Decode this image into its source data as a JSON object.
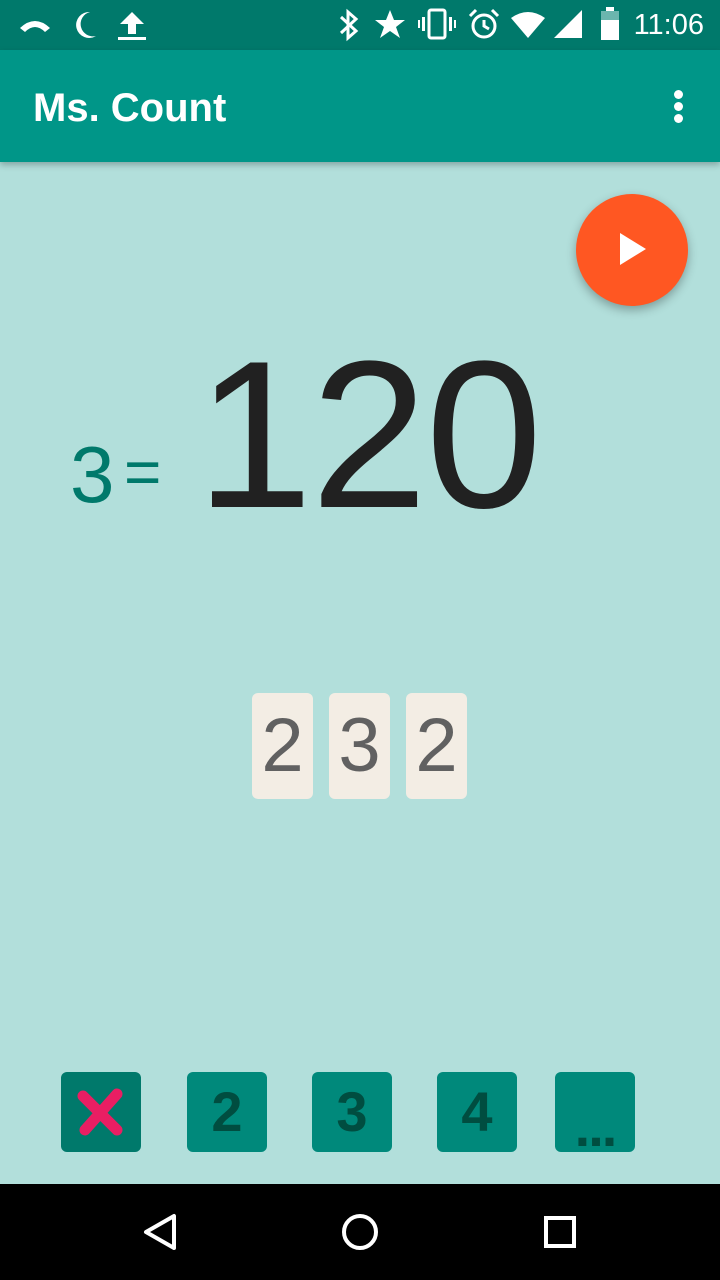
{
  "status_bar": {
    "icons": [
      "signal-arc-icon",
      "moon-icon",
      "upload-icon",
      "bluetooth-icon",
      "star-icon",
      "vibrate-icon",
      "alarm-icon",
      "wifi-icon",
      "cell-signal-icon",
      "battery-icon"
    ],
    "time": "11:06"
  },
  "app_bar": {
    "title": "Ms. Count",
    "menu_icon": "overflow-menu-icon"
  },
  "fab": {
    "icon": "play-icon",
    "color": "#ff5722"
  },
  "main": {
    "multiplier": "3",
    "equals": "=",
    "result": "120",
    "digits": [
      "2",
      "3",
      "2"
    ]
  },
  "bottom_buttons": [
    {
      "label": "",
      "icon": "close-x-icon"
    },
    {
      "label": "2"
    },
    {
      "label": "3"
    },
    {
      "label": "4"
    },
    {
      "label": "..."
    }
  ],
  "colors": {
    "background": "#b2dfdb",
    "primary": "#009688",
    "primary_dark": "#00796b",
    "accent": "#ff5722",
    "tile": "#f3ede4",
    "x_mark": "#e91e63"
  },
  "nav_bar": {
    "icons": [
      "back-icon",
      "home-icon",
      "recents-icon"
    ]
  }
}
